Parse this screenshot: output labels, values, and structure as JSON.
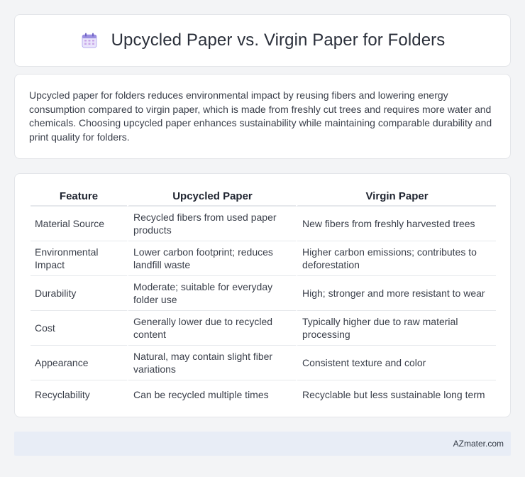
{
  "header": {
    "icon": "calendar-icon",
    "title": "Upcycled Paper vs. Virgin Paper for Folders"
  },
  "intro": {
    "text": "Upcycled paper for folders reduces environmental impact by reusing fibers and lowering energy consumption compared to virgin paper, which is made from freshly cut trees and requires more water and chemicals. Choosing upcycled paper enhances sustainability while maintaining comparable durability and print quality for folders."
  },
  "table": {
    "headers": [
      "Feature",
      "Upcycled Paper",
      "Virgin Paper"
    ],
    "rows": [
      [
        "Material Source",
        "Recycled fibers from used paper products",
        "New fibers from freshly harvested trees"
      ],
      [
        "Environmental Impact",
        "Lower carbon footprint; reduces landfill waste",
        "Higher carbon emissions; contributes to deforestation"
      ],
      [
        "Durability",
        "Moderate; suitable for everyday folder use",
        "High; stronger and more resistant to wear"
      ],
      [
        "Cost",
        "Generally lower due to recycled content",
        "Typically higher due to raw material processing"
      ],
      [
        "Appearance",
        "Natural, may contain slight fiber variations",
        "Consistent texture and color"
      ],
      [
        "Recyclability",
        "Can be recycled multiple times",
        "Recyclable but less sustainable long term"
      ]
    ]
  },
  "footer": {
    "text": "AZmater.com"
  },
  "colors": {
    "background": "#f3f4f6",
    "card": "#ffffff",
    "footer": "#e8edf6",
    "icon_accent": "#8b7fd6"
  }
}
